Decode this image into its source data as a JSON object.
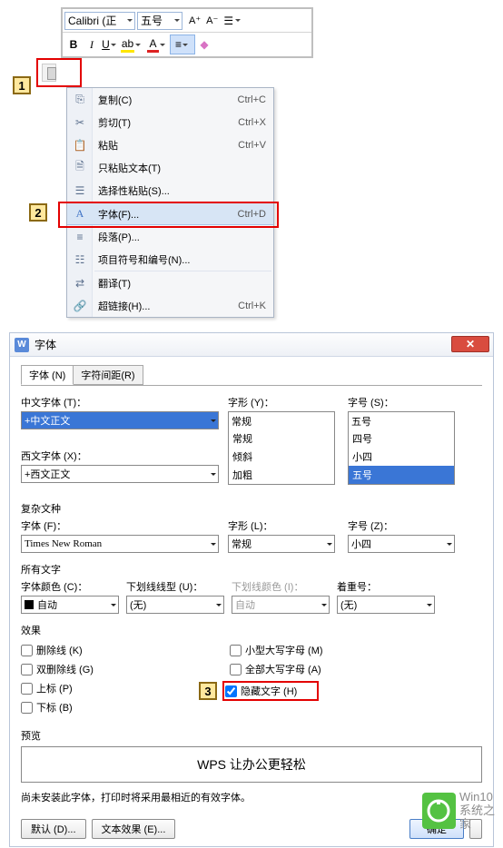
{
  "toolbar": {
    "font_name": "Calibri (正",
    "font_size": "五号",
    "aplus": "A⁺",
    "aminus": "A⁻"
  },
  "markers": {
    "m1": "1",
    "m2": "2",
    "m3": "3"
  },
  "ctx": {
    "copy": {
      "label": "复制(C)",
      "shortcut": "Ctrl+C"
    },
    "cut": {
      "label": "剪切(T)",
      "shortcut": "Ctrl+X"
    },
    "paste": {
      "label": "粘贴",
      "shortcut": "Ctrl+V"
    },
    "paste_text": {
      "label": "只粘贴文本(T)"
    },
    "paste_special": {
      "label": "选择性粘贴(S)..."
    },
    "font": {
      "label": "字体(F)...",
      "shortcut": "Ctrl+D"
    },
    "paragraph": {
      "label": "段落(P)..."
    },
    "bullets": {
      "label": "项目符号和编号(N)..."
    },
    "translate": {
      "label": "翻译(T)"
    },
    "hyperlink": {
      "label": "超链接(H)...",
      "shortcut": "Ctrl+K"
    }
  },
  "dialog": {
    "title": "字体",
    "tabs": {
      "font": "字体 (N)",
      "spacing": "字符间距(R)"
    },
    "labels": {
      "cn_font": "中文字体 (T)：",
      "style": "字形 (Y)：",
      "size": "字号 (S)：",
      "west_font": "西文字体 (X)：",
      "complex": "复杂文种",
      "font_f": "字体 (F)：",
      "style_l": "字形 (L)：",
      "size_z": "字号 (Z)：",
      "all_text": "所有文字",
      "font_color": "字体颜色 (C)：",
      "underline": "下划线线型 (U)：",
      "underline_color": "下划线颜色 (I)：",
      "emphasis": "着重号：",
      "effects": "效果",
      "preview": "预览",
      "preview_note": "尚未安装此字体，打印时将采用最相近的有效字体。"
    },
    "values": {
      "cn_font": "+中文正文",
      "west_font": "+西文正文",
      "complex_font": "Times New Roman",
      "style": "常规",
      "size": "五号",
      "style_list": [
        "常规",
        "倾斜",
        "加粗"
      ],
      "size_list": [
        "四号",
        "小四",
        "五号"
      ],
      "complex_style": "常规",
      "complex_size": "小四",
      "auto": "自动",
      "none": "(无)",
      "preview_text": "WPS 让办公更轻松"
    },
    "checkboxes": {
      "strike": "删除线 (K)",
      "dblstrike": "双删除线 (G)",
      "sup": "上标 (P)",
      "sub": "下标 (B)",
      "smallcaps": "小型大写字母 (M)",
      "allcaps": "全部大写字母 (A)",
      "hidden": "隐藏文字 (H)"
    },
    "buttons": {
      "default": "默认 (D)...",
      "texteffect": "文本效果 (E)...",
      "ok": "确定"
    }
  },
  "watermark": {
    "line1": "Win10",
    "line2": "系统之家"
  }
}
